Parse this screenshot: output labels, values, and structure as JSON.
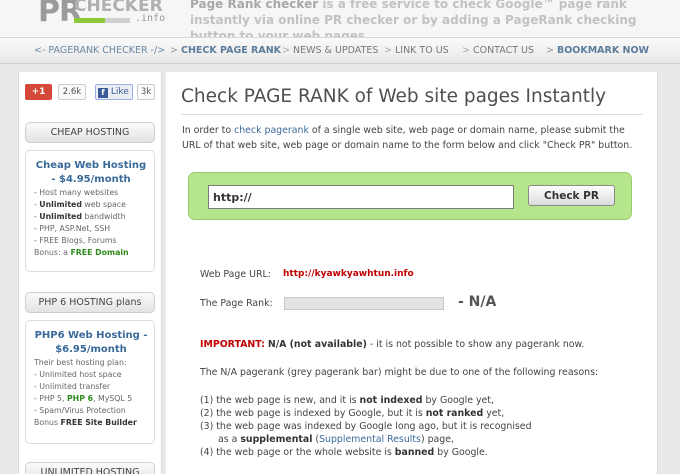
{
  "header": {
    "logo_pr": "PR",
    "logo_checker": "CHECKER",
    "logo_info": ".info",
    "logo_bar_level": 0.55,
    "tagline_strong": "Page Rank checker",
    "tagline_rest": " is a free service to check Google™ page rank instantly via online PR checker or by adding a PageRank checking button to your web pages"
  },
  "nav": {
    "items": [
      "<- PAGERANK CHECKER -/>",
      "CHECK PAGE RANK",
      "NEWS & UPDATES",
      "LINK TO US",
      "CONTACT US",
      "BOOKMARK NOW"
    ]
  },
  "social": {
    "gplus_label": "+1",
    "gplus_count": "2.6k",
    "fb_label": "Like",
    "fb_count": "3k"
  },
  "sidebar": {
    "cheap": {
      "head": "CHEAP HOSTING",
      "title": "Cheap Web Hosting - $4.95/month",
      "lines": [
        {
          "prefix": "- Host many websites",
          "strong": "",
          "suffix": ""
        },
        {
          "prefix": "- ",
          "strong": "Unlimited",
          "suffix": " web space"
        },
        {
          "prefix": "- ",
          "strong": "Unlimited",
          "suffix": " bandwidth"
        },
        {
          "prefix": "- PHP, ASP.Net, SSH",
          "strong": "",
          "suffix": ""
        },
        {
          "prefix": "- FREE Blogs, Forums",
          "strong": "",
          "suffix": ""
        }
      ],
      "bonus_prefix": "Bonus: a ",
      "bonus_strong": "FREE Domain"
    },
    "php": {
      "head": "PHP 6 HOSTING plans",
      "title": "PHP6 Web Hosting - $6.95/month",
      "lines": [
        "Their best hosting plan:",
        "- Unlimited host space",
        "- Unlimited transfer"
      ],
      "php_line_prefix": "- PHP 5, ",
      "php_line_strong": "PHP 6",
      "php_line_suffix": ", MySQL 5",
      "spam_line": "- Spam/Virus Protection",
      "bonus_prefix": "Bonus ",
      "bonus_strong": "FREE Site Builder"
    },
    "unlimited": {
      "head": "UNLIMITED HOSTING"
    }
  },
  "main": {
    "title": "Check PAGE RANK of Web site pages Instantly",
    "intro_1": "In order to ",
    "intro_link": "check pagerank",
    "intro_2": " of a single web site, web page or domain name, please submit the URL of that web site, web page or domain name to the form below and click \"Check PR\" button.",
    "input_value": "http://",
    "button_label": "Check PR",
    "url_label": "Web Page URL:",
    "url_value": "http://kyawkyawhtun.info",
    "rank_label": "The Page Rank:",
    "rank_value": "- N/A",
    "rank_level": 0,
    "important_label": "IMPORTANT:",
    "important_na": "N/A (not available)",
    "important_rest": " - it is not possible to show any pagerank now.",
    "reasons_intro": "The N/A pagerank (grey pagerank bar) might be due to one of the following reasons:",
    "r1_a": "(1) the web page is new, and it is ",
    "r1_b": "not indexed",
    "r1_c": " by Google yet,",
    "r2_a": "(2) the web page is indexed by Google, but it is ",
    "r2_b": "not ranked",
    "r2_c": " yet,",
    "r3_a": "(3) the web page was indexed by Google long ago, but it is recognised",
    "r3_b": "as a ",
    "r3_c": "supplemental",
    "r3_d": " (",
    "r3_e": "Supplemental Results",
    "r3_f": ") page,",
    "r4_a": "(4) the web page or the whole website is ",
    "r4_b": "banned",
    "r4_c": " by Google."
  }
}
